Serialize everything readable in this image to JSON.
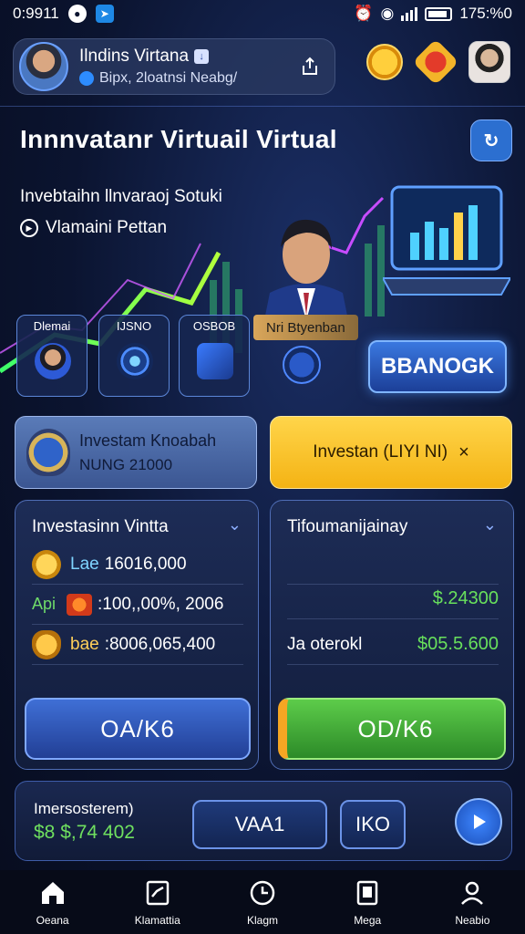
{
  "statusbar": {
    "time": "0:9911",
    "right_text": "175:%0"
  },
  "profile": {
    "name": "Ilndins Virtana",
    "subtitle": "Bipx, 2loatnsi Neabg/"
  },
  "hero": {
    "title": "Innnvatanr Virtuail Virtual",
    "subtitle": "Invebtaihn llnvaraoj Sotuki",
    "play_label": "Vlamaini Pettan",
    "tiles": [
      {
        "label": "Dlemai"
      },
      {
        "label": "IJSNO"
      },
      {
        "label": "OSBOB"
      }
    ],
    "promo_tag": "Nri Btyenban",
    "cta_label": "BBANOGK"
  },
  "invest": {
    "left_title": "Investam Knoabah",
    "left_sub": "NUNG 21000",
    "right_label": "Investan (LIYI NI)",
    "right_close": "×"
  },
  "panel_left": {
    "title": "Investasinn Vintta",
    "rows": [
      {
        "prefix": "Lae",
        "value": "16016,000"
      },
      {
        "prefix": "Api",
        "value": ":100,,00%, 2006"
      },
      {
        "prefix": "bae",
        "value": ":8006,065,400"
      }
    ],
    "button": "OA/K6"
  },
  "panel_right": {
    "title": "Tifoumanijainay",
    "amount_1": "$.24300",
    "row_label": "Ja oterokl",
    "amount_2": "$05.5.600",
    "button": "OD/K6"
  },
  "balance": {
    "label": "Imersosterem)",
    "value": "$8 $,74 402",
    "button_1": "VAA1",
    "button_2": "IKO"
  },
  "nav": [
    {
      "label": "Oeana",
      "icon": "home-icon"
    },
    {
      "label": "Klamattia",
      "icon": "checklist-icon"
    },
    {
      "label": "Klagm",
      "icon": "clock-icon"
    },
    {
      "label": "Mega",
      "icon": "book-icon"
    },
    {
      "label": "Neabio",
      "icon": "user-icon"
    }
  ],
  "colors": {
    "background": "#0b1430",
    "accent_blue": "#2c6fd0",
    "accent_yellow": "#f4b314",
    "accent_green": "#5dcc4a",
    "money_green": "#68e05c"
  }
}
